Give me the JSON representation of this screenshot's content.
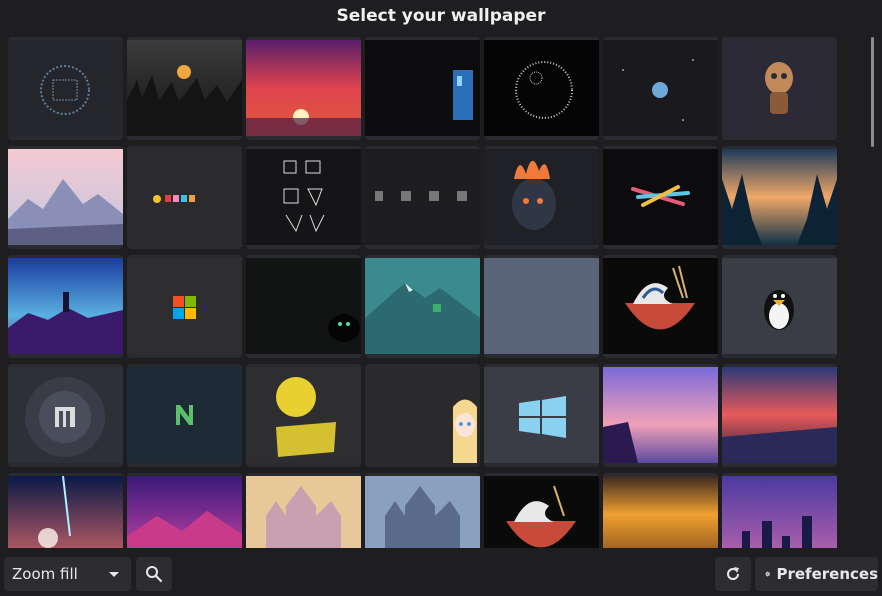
{
  "header": {
    "title": "Select your wallpaper"
  },
  "toolbar": {
    "zoom_mode": "Zoom fill",
    "search_icon": "search-icon",
    "refresh_icon": "refresh-icon",
    "preferences_label": "Preferences",
    "preferences_icon": "gear-icon"
  },
  "wallpapers": [
    {
      "name": "dark-globe-logo"
    },
    {
      "name": "sunset-forest"
    },
    {
      "name": "red-sunset-sea"
    },
    {
      "name": "dark-door"
    },
    {
      "name": "death-star-pixel"
    },
    {
      "name": "earth-space"
    },
    {
      "name": "gas-mask-skull"
    },
    {
      "name": "pink-mountains"
    },
    {
      "name": "pacman-ghosts"
    },
    {
      "name": "line-art-icons"
    },
    {
      "name": "dev-icons"
    },
    {
      "name": "flaming-skull"
    },
    {
      "name": "colorful-lines"
    },
    {
      "name": "forest-valley-dusk"
    },
    {
      "name": "firewatch-purple"
    },
    {
      "name": "windows-logo-shadow"
    },
    {
      "name": "black-cat-eyes"
    },
    {
      "name": "teal-mountain-logo"
    },
    {
      "name": "slate-blank"
    },
    {
      "name": "great-wave-ramen"
    },
    {
      "name": "linux-tux"
    },
    {
      "name": "circle-logo-bats"
    },
    {
      "name": "nvidia-n-logo"
    },
    {
      "name": "yellow-moon-poster"
    },
    {
      "name": "anime-girl-whats-this"
    },
    {
      "name": "windows-logo-blue"
    },
    {
      "name": "cliff-purple-sky"
    },
    {
      "name": "ocean-sunset-pink"
    },
    {
      "name": "space-light-beam"
    },
    {
      "name": "purple-mountains"
    },
    {
      "name": "castle-warm"
    },
    {
      "name": "castle-cool"
    },
    {
      "name": "great-wave-ramen-2"
    },
    {
      "name": "golden-clouds"
    },
    {
      "name": "city-skyline-purple"
    }
  ]
}
